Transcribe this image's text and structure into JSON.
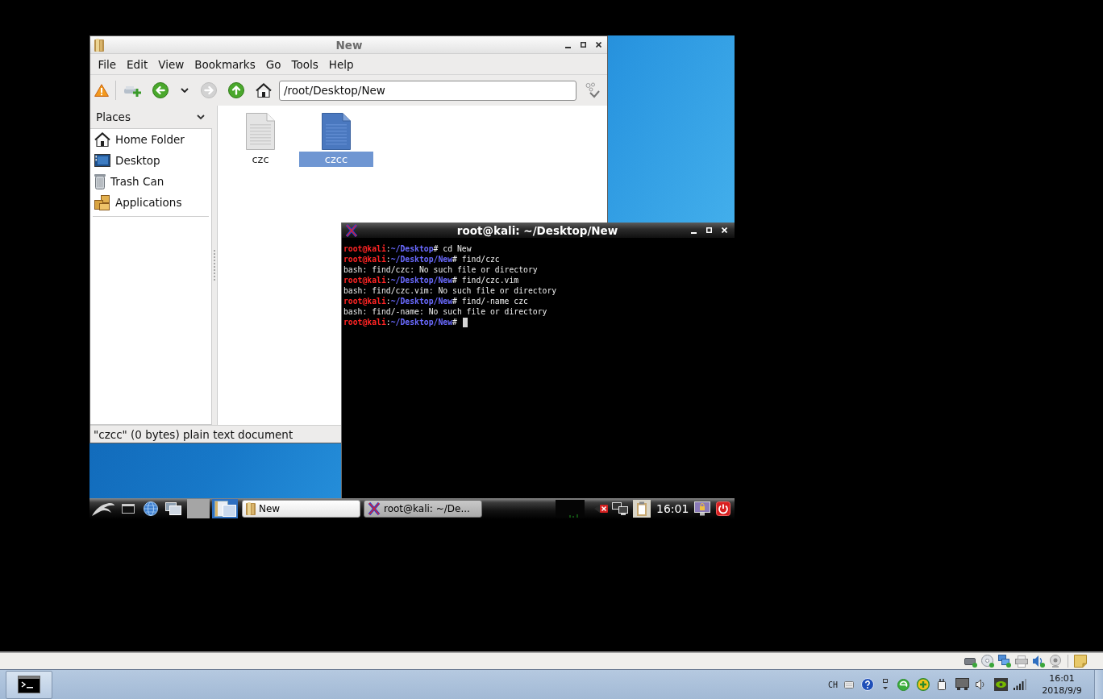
{
  "file_manager": {
    "title": "New",
    "menu": [
      "File",
      "Edit",
      "View",
      "Bookmarks",
      "Go",
      "Tools",
      "Help"
    ],
    "toolbar": {
      "root_warning": true,
      "buttons": [
        {
          "kind": "new_tab",
          "disabled": false
        },
        {
          "kind": "back",
          "disabled": false
        },
        {
          "kind": "history",
          "disabled": false
        },
        {
          "kind": "forward",
          "disabled": true
        },
        {
          "kind": "up",
          "disabled": false
        },
        {
          "kind": "home",
          "disabled": false
        }
      ],
      "address": "/root/Desktop/New"
    },
    "sidebar": {
      "title": "Places",
      "items": [
        {
          "kind": "home",
          "label": "Home Folder",
          "selected": false
        },
        {
          "kind": "desktop",
          "label": "Desktop",
          "selected": false
        },
        {
          "kind": "trash",
          "label": "Trash Can",
          "selected": false
        },
        {
          "kind": "applications",
          "label": "Applications",
          "selected": false
        }
      ]
    },
    "files": [
      {
        "name": "czc",
        "selected": false
      },
      {
        "name": "czcc",
        "selected": true
      }
    ],
    "status_bar": "\"czcc\" (0 bytes) plain text document"
  },
  "terminal": {
    "title": "root@kali: ~/Desktop/New",
    "lines": [
      {
        "kind": "prompt",
        "user": "root@kali",
        "separator": ":",
        "path": "~/Desktop",
        "symbol": "#",
        "command": "cd New",
        "cursor": false
      },
      {
        "kind": "prompt",
        "user": "root@kali",
        "separator": ":",
        "path": "~/Desktop/New",
        "symbol": "#",
        "command": "find/czc",
        "cursor": false
      },
      {
        "kind": "output",
        "text": "bash: find/czc: No such file or directory"
      },
      {
        "kind": "prompt",
        "user": "root@kali",
        "separator": ":",
        "path": "~/Desktop/New",
        "symbol": "#",
        "command": "find/czc.vim",
        "cursor": false
      },
      {
        "kind": "output",
        "text": "bash: find/czc.vim: No such file or directory"
      },
      {
        "kind": "prompt",
        "user": "root@kali",
        "separator": ":",
        "path": "~/Desktop/New",
        "symbol": "#",
        "command": "find/-name czc",
        "cursor": false
      },
      {
        "kind": "output",
        "text": "bash: find/-name: No such file or directory"
      },
      {
        "kind": "prompt",
        "user": "root@kali",
        "separator": ":",
        "path": "~/Desktop/New",
        "symbol": "#",
        "cursor": true
      }
    ]
  },
  "kali_panel": {
    "tasks": [
      {
        "kind": "files",
        "label": "New",
        "selected": false
      },
      {
        "kind": "terminal",
        "label": "root@kali: ~/De...",
        "selected": true
      }
    ],
    "clock": "16:01"
  },
  "host_taskbar": {
    "language": "CH",
    "time": "16:01",
    "date": "2018/9/9"
  }
}
